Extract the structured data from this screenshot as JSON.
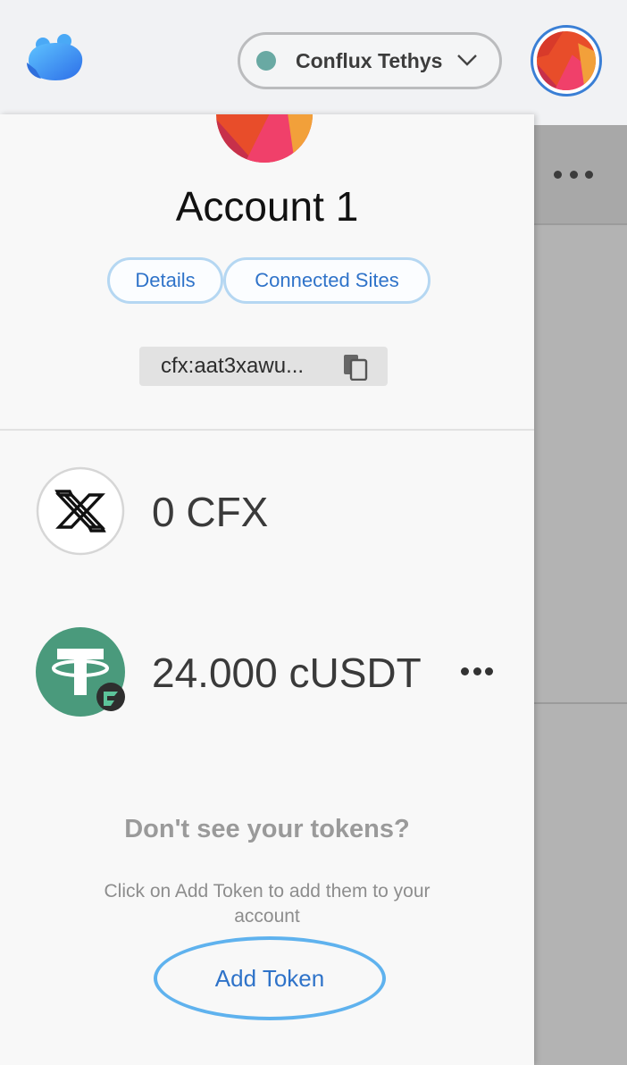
{
  "header": {
    "logo_icon": "fluent-bear-logo-icon",
    "network": {
      "name": "Conflux Tethys",
      "status_color": "#69a9a3",
      "dropdown_icon": "chevron-down-icon"
    },
    "account_avatar_icon": "account-identicon-icon"
  },
  "account": {
    "name": "Account 1",
    "details_label": "Details",
    "connected_sites_label": "Connected Sites",
    "address": "cfx:aat3xawu...",
    "copy_icon": "copy-icon"
  },
  "tokens": [
    {
      "amount": "0 CFX",
      "icon": "conflux-token-icon"
    },
    {
      "amount": "24.000 cUSDT",
      "icon": "tether-token-icon",
      "more_icon": "more-horizontal-icon"
    }
  ],
  "empty_hint": {
    "title": "Don't see your tokens?",
    "message": "Click on Add Token to add them to your account",
    "add_token_label": "Add Token"
  },
  "colors": {
    "accent": "#2f73c9",
    "pill_border": "#b5d7f2",
    "add_token_ring": "#5fb2ee",
    "tether_green": "#4a9a7c"
  }
}
